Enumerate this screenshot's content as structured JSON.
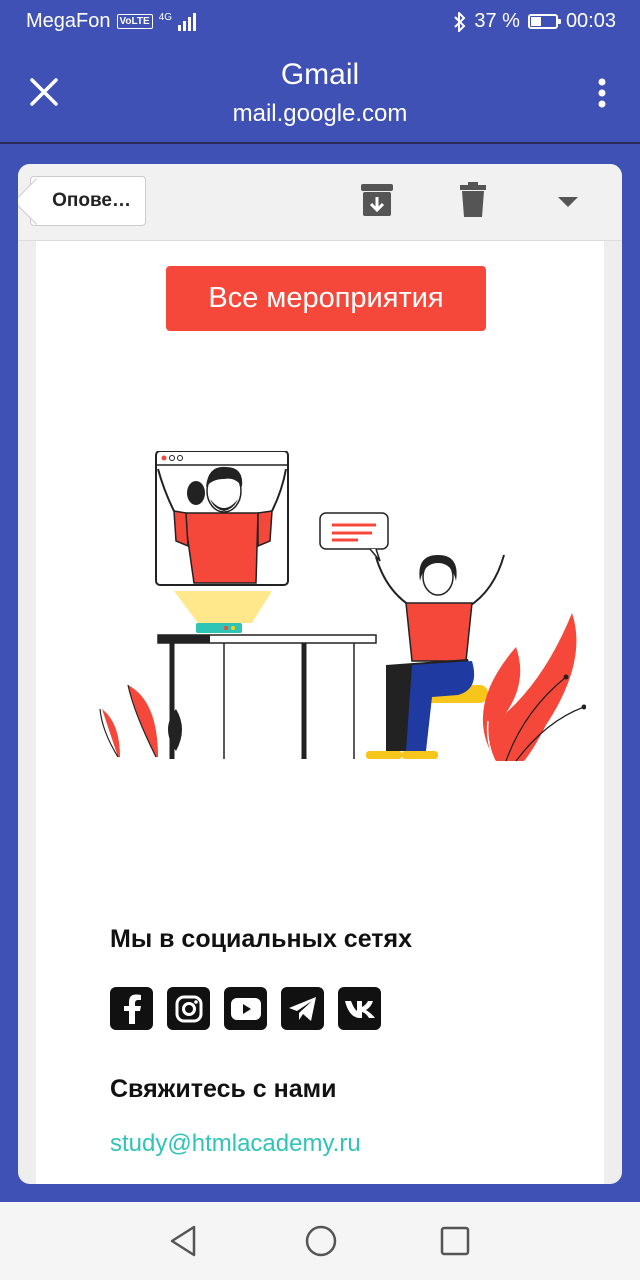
{
  "status_bar": {
    "carrier": "MegaFon",
    "volte": "VoLTE",
    "network": "4G",
    "battery_percent": "37 %",
    "battery_level": 0.37,
    "time": "00:03"
  },
  "app_bar": {
    "title": "Gmail",
    "url": "mail.google.com"
  },
  "toolbar": {
    "back_label": "Опове…",
    "icons": [
      "archive-icon",
      "trash-icon",
      "dropdown-icon"
    ]
  },
  "email": {
    "cta_label": "Все мероприятия",
    "social_title": "Мы в социальных сетях",
    "social_icons": [
      "facebook-icon",
      "instagram-icon",
      "youtube-icon",
      "telegram-icon",
      "vk-icon"
    ],
    "contact_title": "Свяжитесь с нами",
    "contact_email": "study@htmlacademy.ru"
  },
  "nav_bar": {
    "icons": [
      "back-icon",
      "home-icon",
      "recents-icon"
    ]
  },
  "colors": {
    "app_bar": "#3f51b5",
    "accent": "#f5483b",
    "link": "#2ec4b6"
  }
}
